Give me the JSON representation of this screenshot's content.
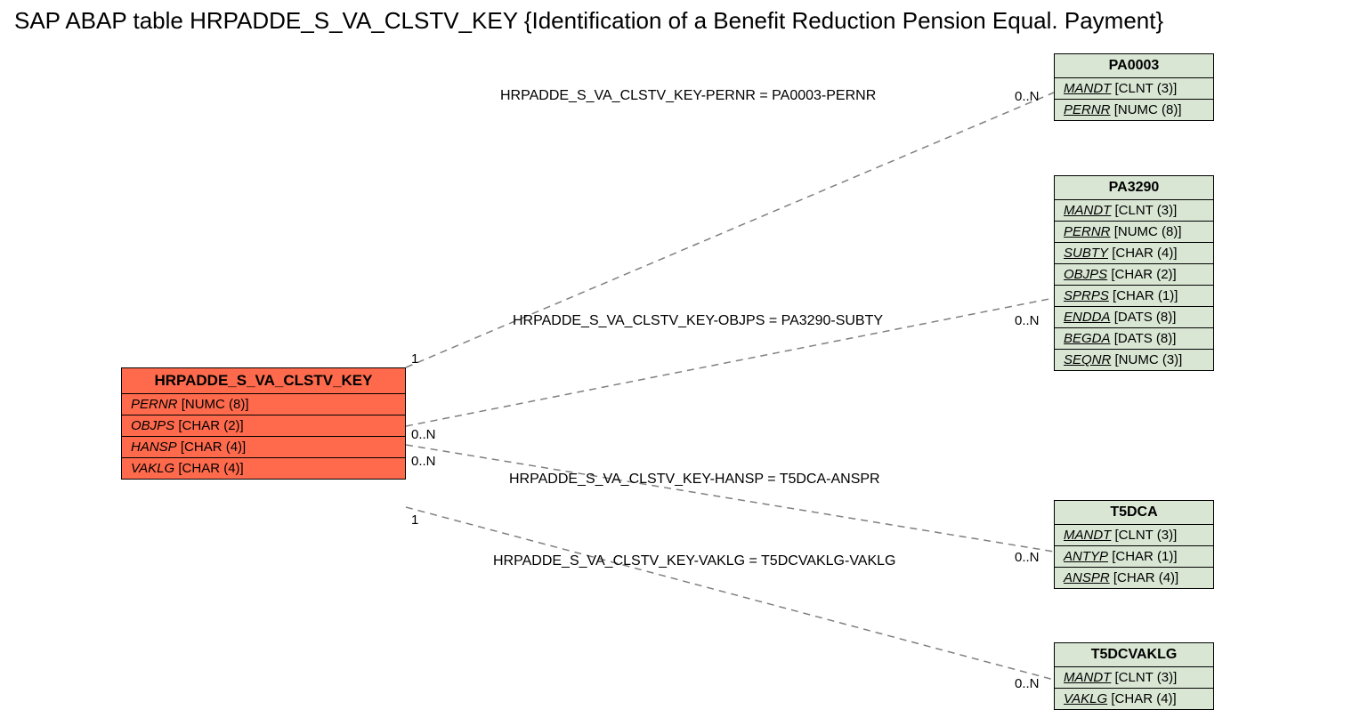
{
  "title": "SAP ABAP table HRPADDE_S_VA_CLSTV_KEY {Identification of a Benefit Reduction Pension Equal. Payment}",
  "main": {
    "name": "HRPADDE_S_VA_CLSTV_KEY",
    "fields": [
      {
        "name": "PERNR",
        "type": "[NUMC (8)]"
      },
      {
        "name": "OBJPS",
        "type": "[CHAR (2)]"
      },
      {
        "name": "HANSP",
        "type": "[CHAR (4)]"
      },
      {
        "name": "VAKLG",
        "type": "[CHAR (4)]"
      }
    ]
  },
  "refs": {
    "pa0003": {
      "name": "PA0003",
      "fields": [
        {
          "name": "MANDT",
          "type": "[CLNT (3)]"
        },
        {
          "name": "PERNR",
          "type": "[NUMC (8)]"
        }
      ]
    },
    "pa3290": {
      "name": "PA3290",
      "fields": [
        {
          "name": "MANDT",
          "type": "[CLNT (3)]"
        },
        {
          "name": "PERNR",
          "type": "[NUMC (8)]"
        },
        {
          "name": "SUBTY",
          "type": "[CHAR (4)]"
        },
        {
          "name": "OBJPS",
          "type": "[CHAR (2)]"
        },
        {
          "name": "SPRPS",
          "type": "[CHAR (1)]"
        },
        {
          "name": "ENDDA",
          "type": "[DATS (8)]"
        },
        {
          "name": "BEGDA",
          "type": "[DATS (8)]"
        },
        {
          "name": "SEQNR",
          "type": "[NUMC (3)]"
        }
      ]
    },
    "t5dca": {
      "name": "T5DCA",
      "fields": [
        {
          "name": "MANDT",
          "type": "[CLNT (3)]"
        },
        {
          "name": "ANTYP",
          "type": "[CHAR (1)]"
        },
        {
          "name": "ANSPR",
          "type": "[CHAR (4)]"
        }
      ]
    },
    "t5dcvaklg": {
      "name": "T5DCVAKLG",
      "fields": [
        {
          "name": "MANDT",
          "type": "[CLNT (3)]"
        },
        {
          "name": "VAKLG",
          "type": "[CHAR (4)]"
        }
      ]
    }
  },
  "rel": {
    "r1": "HRPADDE_S_VA_CLSTV_KEY-PERNR = PA0003-PERNR",
    "r2": "HRPADDE_S_VA_CLSTV_KEY-OBJPS = PA3290-SUBTY",
    "r3": "HRPADDE_S_VA_CLSTV_KEY-HANSP = T5DCA-ANSPR",
    "r4": "HRPADDE_S_VA_CLSTV_KEY-VAKLG = T5DCVAKLG-VAKLG"
  },
  "card": {
    "one": "1",
    "zn": "0..N"
  }
}
